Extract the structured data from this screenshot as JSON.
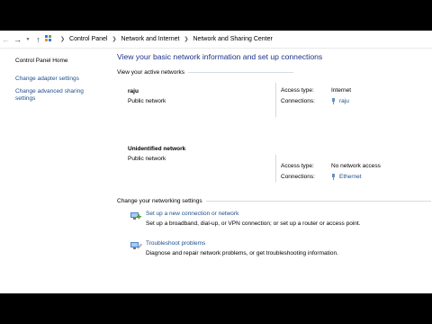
{
  "breadcrumb": [
    "Control Panel",
    "Network and Internet",
    "Network and Sharing Center"
  ],
  "left_pane": {
    "home": "Control Panel Home",
    "links": [
      "Change adapter settings",
      "Change advanced sharing settings"
    ]
  },
  "main": {
    "title": "View your basic network information and set up connections",
    "active_networks_header": "View your active networks",
    "networks": [
      {
        "name": "raju",
        "type": "Public network",
        "access_label": "Access type:",
        "access_value": "Internet",
        "connections_label": "Connections:",
        "connection": "raju"
      },
      {
        "name": "Unidentified network",
        "type": "Public network",
        "access_label": "Access type:",
        "access_value": "No network access",
        "connections_label": "Connections:",
        "connection": "Ethernet"
      }
    ],
    "change_header": "Change your networking settings",
    "tasks": [
      {
        "link": "Set up a new connection or network",
        "desc": "Set up a broadband, dial-up, or VPN connection; or set up a router or access point."
      },
      {
        "link": "Troubleshoot problems",
        "desc": "Diagnose and repair network problems, or get troubleshooting information."
      }
    ]
  },
  "icons": [
    "back-arrow-icon",
    "forward-arrow-icon",
    "dropdown-icon",
    "up-arrow-icon",
    "control-panel-icon",
    "network-plug-icon",
    "new-connection-icon",
    "troubleshoot-icon"
  ],
  "colors": {
    "link": "#1e4e8c",
    "title": "#1e3287"
  }
}
